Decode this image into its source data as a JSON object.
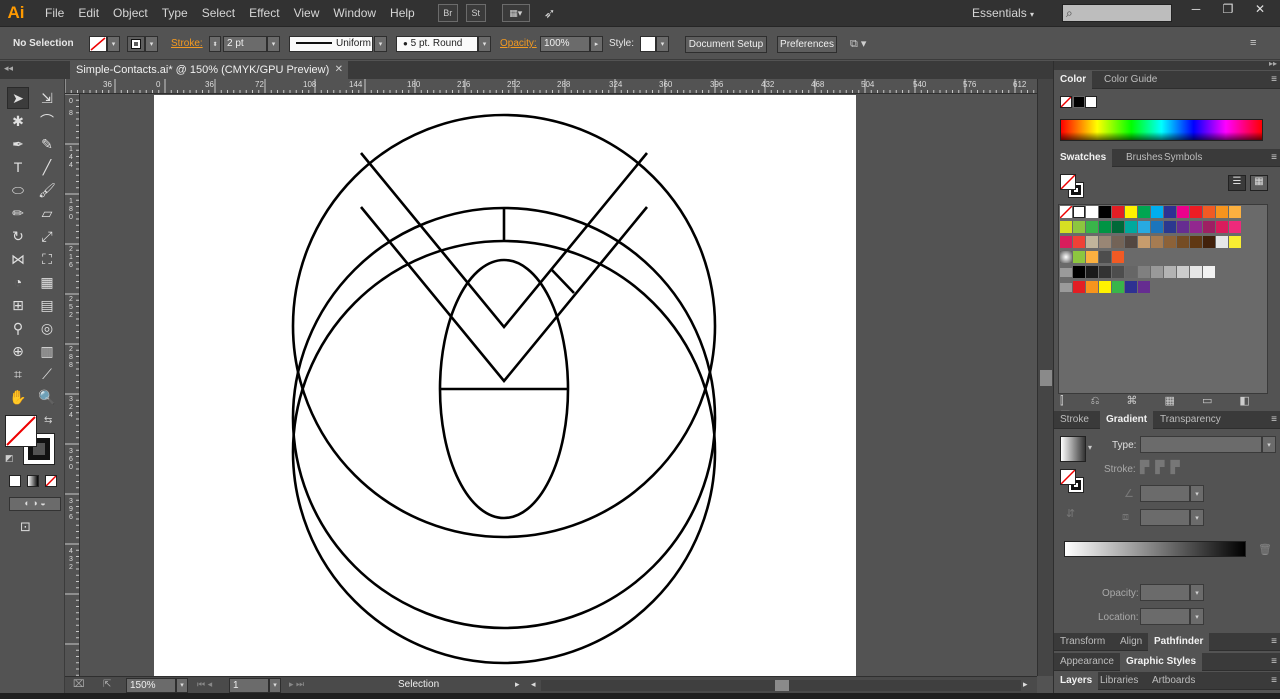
{
  "app": {
    "logo": "Ai",
    "workspace": "Essentials"
  },
  "menu": [
    "File",
    "Edit",
    "Object",
    "Type",
    "Select",
    "Effect",
    "View",
    "Window",
    "Help"
  ],
  "menubar_buttons": [
    "Br",
    "St"
  ],
  "window_controls": [
    "─",
    "❐",
    "✕"
  ],
  "control_bar": {
    "selection_status": "No Selection",
    "stroke_label": "Stroke:",
    "stroke_weight": "2 pt",
    "profile": "Uniform",
    "brush": "5 pt. Round",
    "opacity_label": "Opacity:",
    "opacity": "100%",
    "style_label": "Style:",
    "document_setup": "Document Setup",
    "preferences": "Preferences"
  },
  "document_tab": {
    "title": "Simple-Contacts.ai* @ 150% (CMYK/GPU Preview)",
    "close": "✕"
  },
  "hruler_labels": [
    "36",
    "0",
    "36",
    "72",
    "108",
    "144",
    "180",
    "216",
    "252",
    "288",
    "324",
    "360",
    "396",
    "432",
    "468",
    "504",
    "540",
    "576",
    "612"
  ],
  "vruler_labels": [
    "0",
    "8",
    "1 4 4",
    "1 8 0",
    "2 1 6",
    "2 5 2",
    "2 8 8",
    "3 2 4",
    "3 6 0",
    "3 9 6",
    "4 3 2"
  ],
  "status": {
    "zoom": "150%",
    "artboard": "1",
    "tool": "Selection"
  },
  "panels": {
    "color_tabs": [
      "Color",
      "Color Guide"
    ],
    "swatch_tabs": [
      "Swatches",
      "Brushes",
      "Symbols"
    ],
    "gradient_tabs": [
      "Stroke",
      "Gradient",
      "Transparency"
    ],
    "gradient": {
      "type_label": "Type:",
      "stroke_label": "Stroke:",
      "opacity_label": "Opacity:",
      "location_label": "Location:"
    },
    "bottom_tabs_1": [
      "Transform",
      "Align",
      "Pathfinder"
    ],
    "bottom_tabs_2": [
      "Appearance",
      "Graphic Styles"
    ],
    "bottom_tabs_3": [
      "Layers",
      "Libraries",
      "Artboards"
    ]
  },
  "colors": {
    "accent": "#f39a21",
    "ui_dark": "#323232",
    "ui_mid": "#535353",
    "artboard": "#ffffff"
  }
}
